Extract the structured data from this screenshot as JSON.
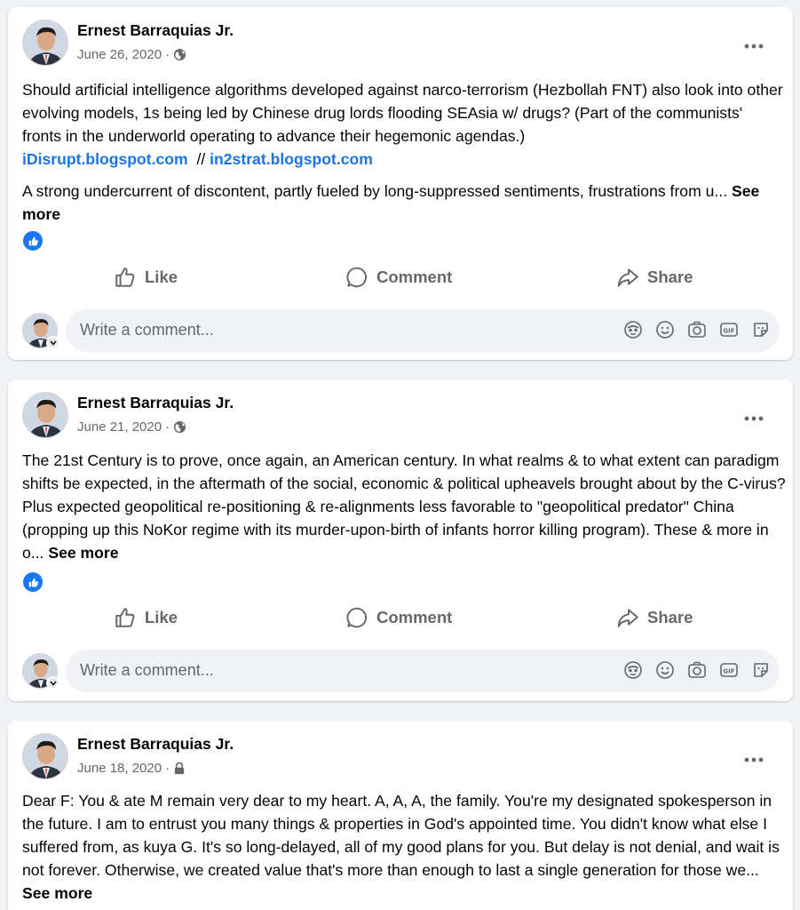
{
  "posts": [
    {
      "author": "Ernest Barraquias Jr.",
      "date": "June 26, 2020",
      "separator": "·",
      "privacy_icon": "globe-icon",
      "paragraphs": [
        "Should artificial intelligence algorithms developed against narco-terrorism (Hezbollah FNT) also look into other evolving models, 1s being led by Chinese drug lords flooding SEAsia w/ drugs? (Part of the communists' fronts in the underworld operating to advance their hegemonic agendas.)",
        "A strong undercurrent of discontent, partly fueled by long-suppressed sentiments, frustrations from u..."
      ],
      "link1": "iDisrupt.blogspot.com",
      "link_sep": "//",
      "link2": "in2strat.blogspot.com",
      "see_more": "See more"
    },
    {
      "author": "Ernest Barraquias Jr.",
      "date": "June 21, 2020",
      "separator": "·",
      "privacy_icon": "globe-icon",
      "paragraphs": [
        "The 21st Century is to prove, once again, an American century. In what realms & to what extent can paradigm shifts be expected, in the aftermath of the social, economic & political upheavels brought about by the C-virus? Plus expected geopolitical re-positioning & re-alignments less favorable to \"geopolitical predator\" China (propping up this NoKor regime with its murder-upon-birth of infants horror killing program). These & more in o..."
      ],
      "see_more": "See more"
    },
    {
      "author": "Ernest Barraquias Jr.",
      "date": "June 18, 2020",
      "separator": "·",
      "privacy_icon": "lock-icon",
      "paragraphs": [
        "Dear F: You & ate M remain very dear to my heart. A, A, A, the family. You're my designated spokesperson in the future. I am to entrust you many things & properties in God's appointed time. You didn't know what else I suffered from, as kuya G. It's so long-delayed, all of my good plans for you. But delay is not denial, and wait is not forever. Otherwise, we created value that's more than enough to last a single generation for those we..."
      ],
      "see_more": "See more"
    }
  ],
  "actions": {
    "like": "Like",
    "comment": "Comment",
    "share": "Share"
  },
  "comment_box": {
    "placeholder": "Write a comment...",
    "icons": [
      "avatar-sticker-icon",
      "emoji-icon",
      "camera-icon",
      "gif-icon",
      "sticker-icon"
    ]
  },
  "colors": {
    "background": "#f0f2f5",
    "card": "#ffffff",
    "link": "#1b74e4",
    "secondary_text": "#65676b",
    "like_blue": "#1877f2"
  }
}
